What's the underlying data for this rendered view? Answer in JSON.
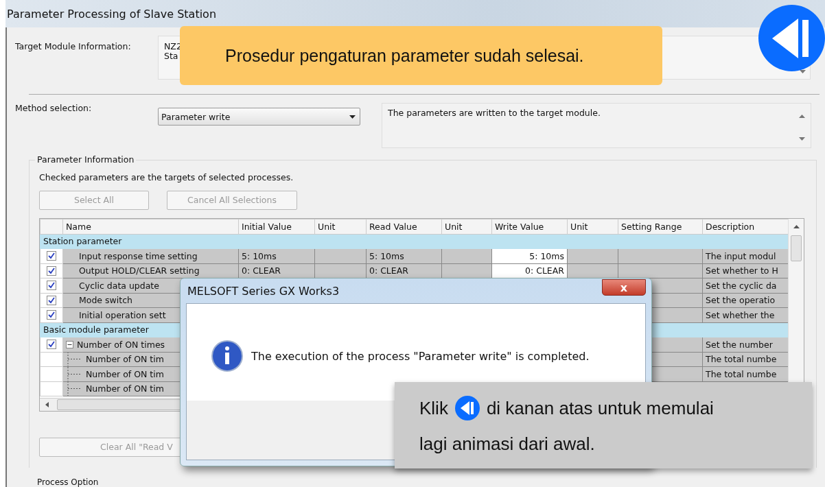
{
  "window": {
    "title": "Parameter Processing of Slave Station"
  },
  "target_module": {
    "label": "Target Module Information:",
    "lines": [
      "NZ2",
      "Sta"
    ]
  },
  "method": {
    "label": "Method selection:",
    "value": "Parameter write",
    "description": "The parameters are written to the target module."
  },
  "parameter_information": {
    "legend": "Parameter Information",
    "hint": "Checked parameters are the targets of selected processes.",
    "buttons": [
      {
        "label": "Select All",
        "disabled": true
      },
      {
        "label": "Cancel All Selections",
        "disabled": true
      }
    ],
    "table": {
      "columns": [
        "Name",
        "Initial Value",
        "Unit",
        "Read Value",
        "Unit",
        "Write Value",
        "Unit",
        "Setting Range",
        "Description"
      ],
      "groups": [
        {
          "title": "Station parameter",
          "rows": [
            {
              "kind": "item",
              "checked": true,
              "name": "Input response time setting",
              "initial_value": "5: 10ms",
              "read_value": "5: 10ms",
              "write_value": "5: 10ms",
              "description": "The input modul"
            },
            {
              "kind": "item",
              "checked": true,
              "name": "Output HOLD/CLEAR setting",
              "initial_value": "0: CLEAR",
              "read_value": "0: CLEAR",
              "write_value": "0: CLEAR",
              "description": "Set whether to H"
            },
            {
              "kind": "item",
              "checked": true,
              "name": "Cyclic data update",
              "description": "Set the cyclic da"
            },
            {
              "kind": "item",
              "checked": true,
              "name": "Mode switch",
              "description": "Set the operatio"
            },
            {
              "kind": "item",
              "checked": true,
              "name": "Initial operation sett",
              "description": "Set whether the"
            }
          ]
        },
        {
          "title": "Basic module parameter",
          "rows": [
            {
              "kind": "parent",
              "checked": true,
              "expanded": true,
              "name": "Number of ON times",
              "description": "Set the number"
            },
            {
              "kind": "child",
              "name": "Number of ON tim",
              "description": "The total numbe"
            },
            {
              "kind": "child",
              "name": "Number of ON tim",
              "description": "The total numbe"
            },
            {
              "kind": "child",
              "name": "Number of ON tim"
            }
          ]
        }
      ]
    },
    "clear_button": {
      "label": "Clear All \"Read V"
    }
  },
  "process_option": {
    "label": "Process Option"
  },
  "dialog": {
    "title": "MELSOFT Series GX Works3",
    "close": "x",
    "message": "The execution of the process \"Parameter write\" is completed."
  },
  "banner": {
    "text": "Prosedur pengaturan parameter sudah selesai."
  },
  "callout": {
    "prefix": "Klik",
    "line_1": "di kanan atas untuk memulai",
    "line_2": "lagi animasi dari awal."
  }
}
